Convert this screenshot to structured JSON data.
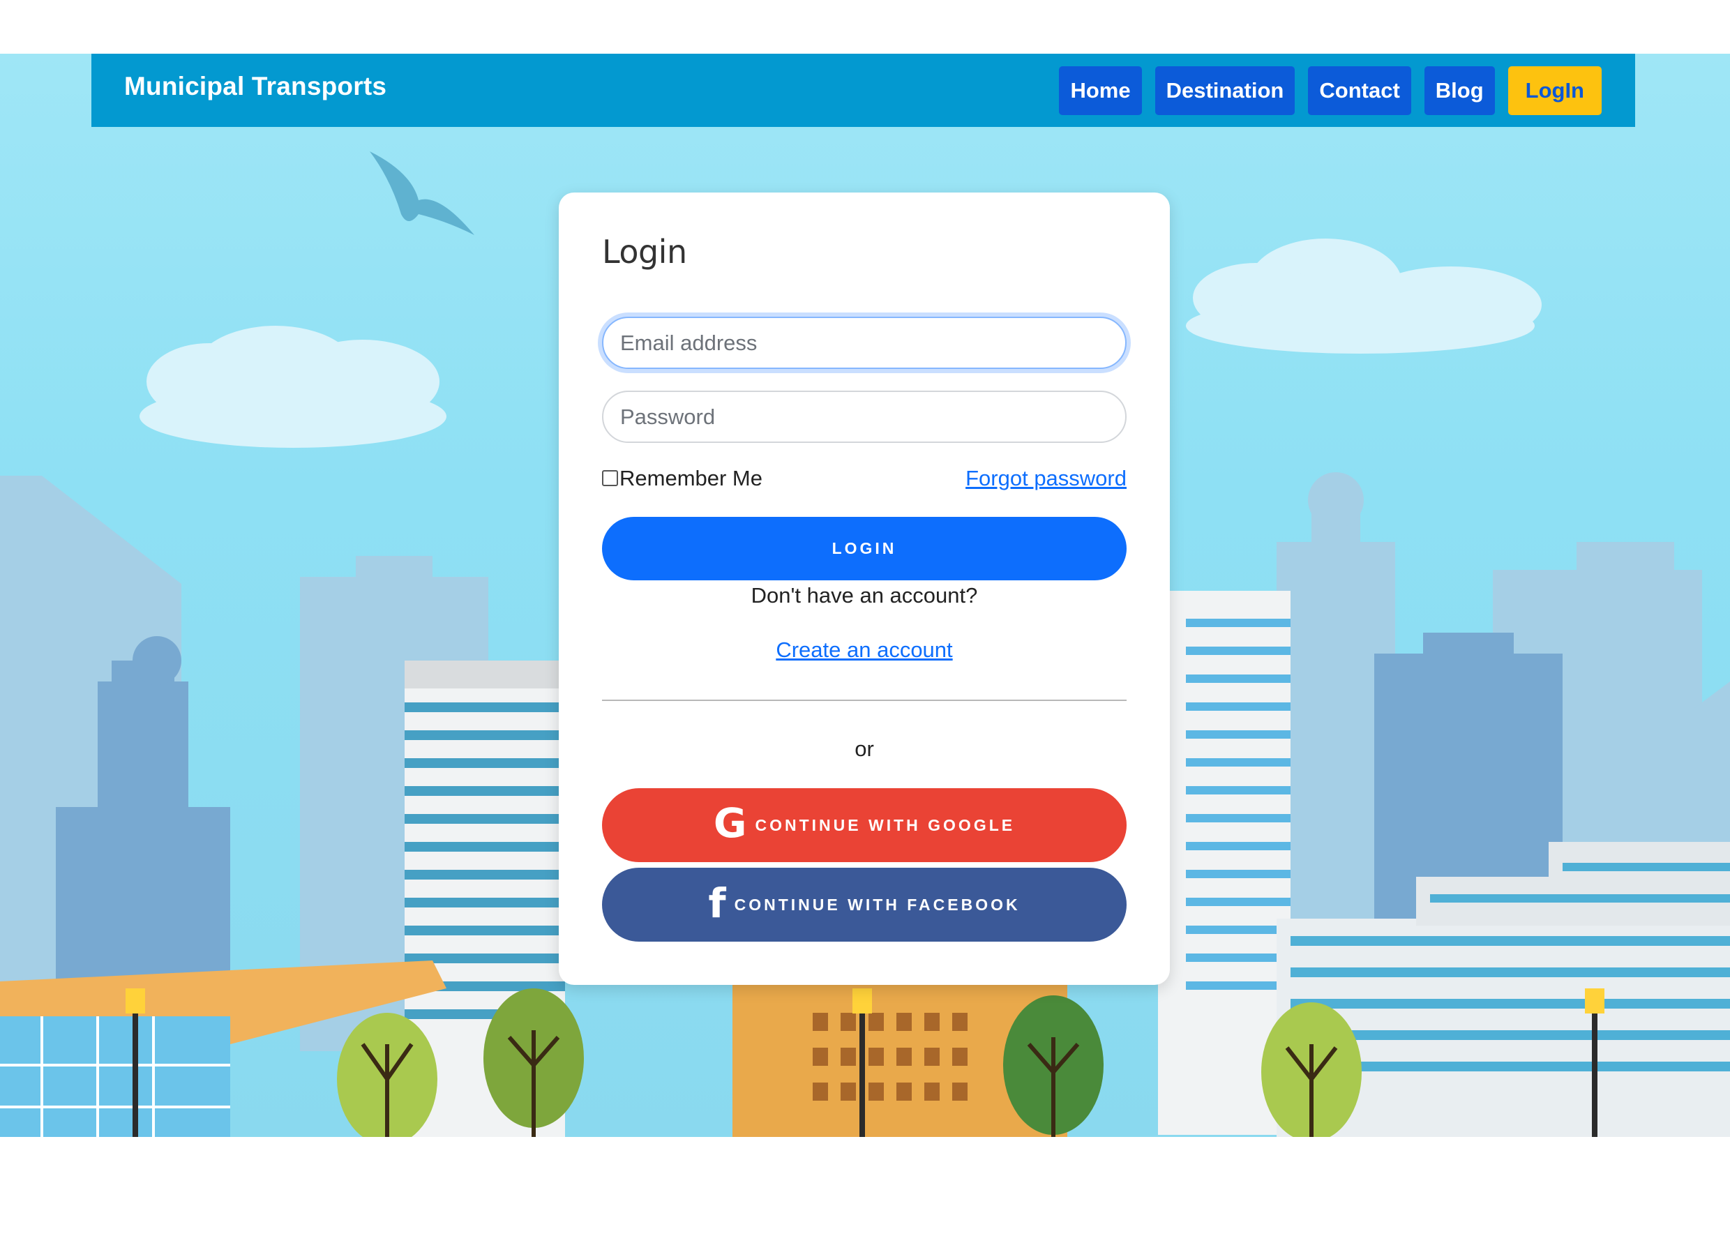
{
  "navbar": {
    "brand": "Municipal Transports",
    "links": [
      {
        "label": "Home"
      },
      {
        "label": "Destination"
      },
      {
        "label": "Contact"
      },
      {
        "label": "Blog"
      },
      {
        "label": "LogIn"
      }
    ]
  },
  "login_card": {
    "title": "Login",
    "email_placeholder": "Email address",
    "password_placeholder": "Password",
    "remember_label": "Remember Me",
    "forgot_label": "Forgot password",
    "submit_label": "LOGIN",
    "no_account_text": "Don't have an account?",
    "create_account_label": "Create an account",
    "or_text": "or",
    "google_label": "CONTINUE WITH GOOGLE",
    "facebook_label": "CONTINUE WITH FACEBOOK"
  },
  "icons": {
    "google": "G",
    "facebook": "f"
  },
  "colors": {
    "navbar": "#0399d0",
    "nav_button": "#0c5bd9",
    "active_login": "#fdc20f",
    "primary": "#0d6efd",
    "google": "#ea4335",
    "facebook": "#3b5998",
    "sky": "#8ee0f4"
  }
}
